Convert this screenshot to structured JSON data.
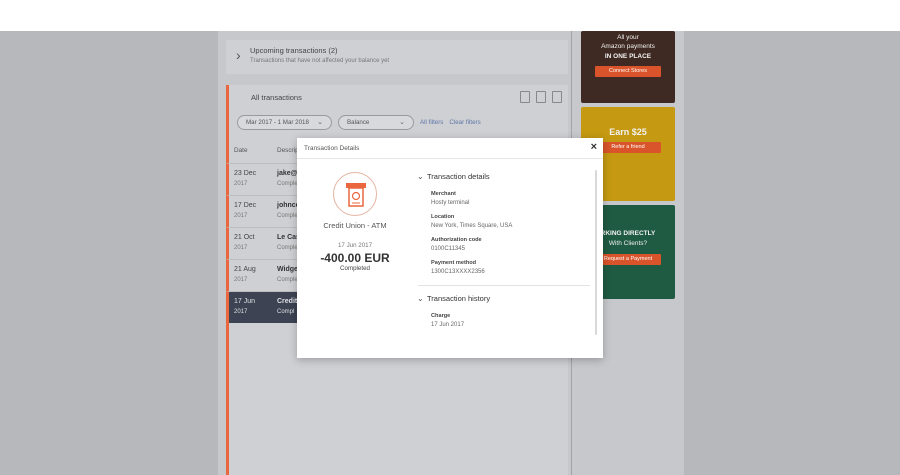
{
  "upcoming": {
    "title": "Upcoming transactions (2)",
    "subtitle": "Transactions that have not affected your balance yet"
  },
  "transactions": {
    "heading": "All transactions",
    "filters": {
      "date_range": "Mar 2017 - 1 Mar 2018",
      "balance": "Balance",
      "all_filters": "All filters",
      "clear_filters": "Clear filters"
    },
    "columns": {
      "date": "Date",
      "description": "Descript"
    },
    "rows": [
      {
        "day": "23 Dec",
        "year": "2017",
        "name": "jake@c",
        "status": "Complet"
      },
      {
        "day": "17 Dec",
        "year": "2017",
        "name": "johnco",
        "status": "Comple"
      },
      {
        "day": "21 Oct",
        "year": "2017",
        "name": "Le Caso",
        "status": "Comple"
      },
      {
        "day": "21 Aug",
        "year": "2017",
        "name": "Widget",
        "status": "Comple"
      },
      {
        "day": "17 Jun",
        "year": "2017",
        "name": "Credit",
        "status": "Compl"
      }
    ]
  },
  "ads": {
    "ad1": {
      "line1": "All your",
      "line2": "Amazon payments",
      "line3": "IN ONE PLACE",
      "button": "Connect Stores"
    },
    "ad2": {
      "headline": "Earn $25",
      "button": "Refer a friend"
    },
    "ad3": {
      "line1": "RKING DIRECTLY",
      "line2": "With Clients?",
      "button": "Request a Payment"
    }
  },
  "modal": {
    "title": "Transaction Details",
    "close": "×",
    "merchant_icon": "atm-icon",
    "merchant": "Credit Union - ATM",
    "date": "17 Jun 2017",
    "amount": "-400.00 EUR",
    "status": "Completed",
    "details": {
      "heading": "Transaction details",
      "merchant_label": "Merchant",
      "merchant_value": "Hosty terminal",
      "location_label": "Location",
      "location_value": "New York, Times Square, USA",
      "auth_label": "Authorization code",
      "auth_value": "0100C11345",
      "payment_label": "Payment method",
      "payment_value": "1300C13XXXX2356"
    },
    "history": {
      "heading": "Transaction history",
      "charge_label": "Charge",
      "charge_date": "17 Jun 2017"
    }
  },
  "colors": {
    "accent": "#e9663f",
    "overlay": "#b7b8bc",
    "selected_row": "#3d4352"
  }
}
